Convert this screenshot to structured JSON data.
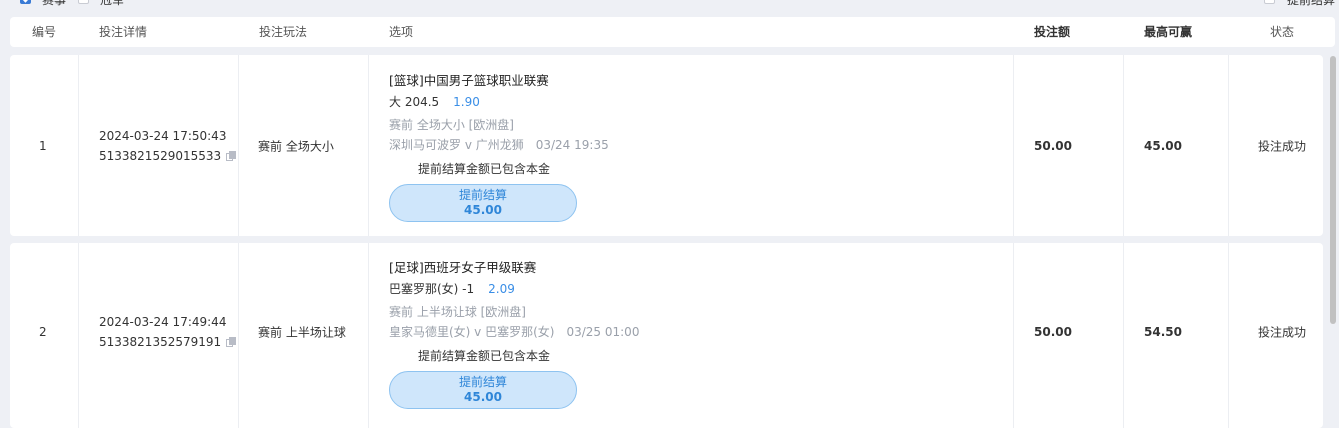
{
  "filters": {
    "match_label": "赛事",
    "champion_label": "冠军",
    "early_settle_label": "提前结算"
  },
  "columns": {
    "id": "编号",
    "detail": "投注详情",
    "play": "投注玩法",
    "option": "选项",
    "stake": "投注额",
    "max_win": "最高可赢",
    "status": "状态"
  },
  "rows": [
    {
      "id": "1",
      "time": "2024-03-24 17:50:43",
      "order_no": "5133821529015533",
      "play": "赛前 全场大小",
      "league": "[篮球]中国男子篮球职业联赛",
      "pick": "大 204.5",
      "odds": "1.90",
      "market": "赛前   全场大小   [欧洲盘]",
      "teams": "深圳马可波罗 v 广州龙狮",
      "match_time": "03/24 19:35",
      "settle_note": "提前结算金额已包含本金",
      "settle_label": "提前结算",
      "settle_amount": "45.00",
      "stake": "50.00",
      "max_win": "45.00",
      "status": "投注成功"
    },
    {
      "id": "2",
      "time": "2024-03-24 17:49:44",
      "order_no": "5133821352579191",
      "play": "赛前 上半场让球",
      "league": "[足球]西班牙女子甲级联赛",
      "pick": "巴塞罗那(女) -1",
      "odds": "2.09",
      "market": "赛前   上半场让球   [欧洲盘]",
      "teams": "皇家马德里(女) v 巴塞罗那(女)",
      "match_time": "03/25 01:00",
      "settle_note": "提前结算金额已包含本金",
      "settle_label": "提前结算",
      "settle_amount": "45.00",
      "stake": "50.00",
      "max_win": "54.50",
      "status": "投注成功"
    }
  ]
}
